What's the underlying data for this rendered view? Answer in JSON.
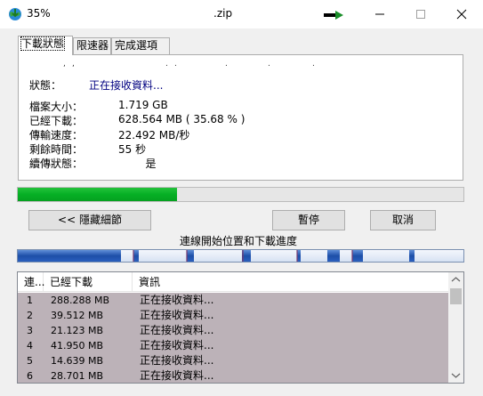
{
  "window": {
    "title_percent": "35%",
    "title_file": ".zip",
    "accent": "#06b025"
  },
  "tabs": [
    {
      "label": "下載狀態",
      "active": true
    },
    {
      "label": "限速器",
      "active": false
    },
    {
      "label": "完成選項",
      "active": false
    }
  ],
  "status": {
    "label": "狀態：",
    "value": "正在接收資料..."
  },
  "info": [
    {
      "label": "檔案大小：",
      "value": "1.719  GB"
    },
    {
      "label": "已經下載：",
      "value": "628.564  MB  ( 35.68 % )"
    },
    {
      "label": "傳輸速度：",
      "value": "22.492  MB/秒"
    },
    {
      "label": "剩餘時間：",
      "value": "55 秒"
    },
    {
      "label": "續傳狀態：",
      "value": "        是"
    }
  ],
  "progress": {
    "fraction": 0.3568
  },
  "buttons": {
    "hide_details": "<< 隱藏細節",
    "pause": "暫停",
    "cancel": "取消"
  },
  "segments": {
    "title": "連線開始位置和下載進度"
  },
  "list": {
    "columns": [
      "連...",
      "已經下載",
      "資訊"
    ],
    "rows": [
      {
        "n": "1",
        "downloaded": "288.288  MB",
        "info": "正在接收資料..."
      },
      {
        "n": "2",
        "downloaded": "39.512  MB",
        "info": "正在接收資料..."
      },
      {
        "n": "3",
        "downloaded": "21.123  MB",
        "info": "正在接收資料..."
      },
      {
        "n": "4",
        "downloaded": "41.950  MB",
        "info": "正在接收資料..."
      },
      {
        "n": "5",
        "downloaded": "14.639  MB",
        "info": "正在接收資料..."
      },
      {
        "n": "6",
        "downloaded": "28.701  MB",
        "info": "正在接收資料..."
      }
    ]
  }
}
